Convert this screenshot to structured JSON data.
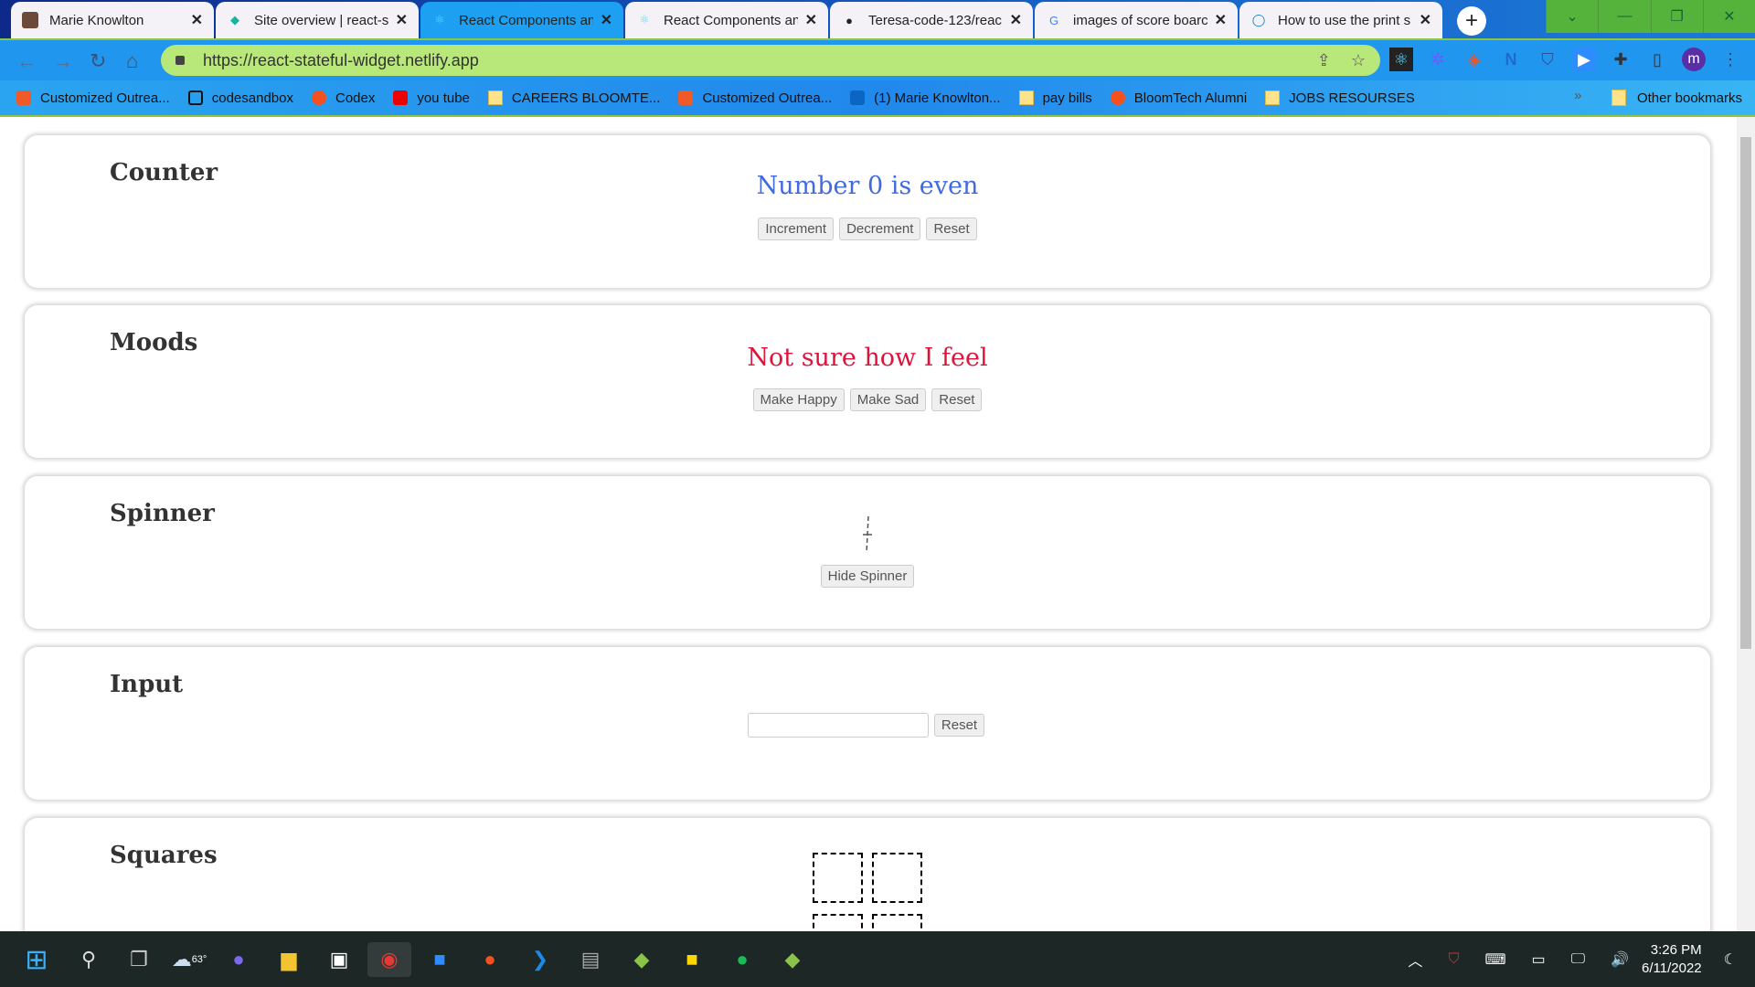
{
  "browser": {
    "tabs": [
      {
        "title": "Marie Knowlton",
        "icon": "profile-photo-icon"
      },
      {
        "title": "Site overview | react-s",
        "icon": "netlify-icon"
      },
      {
        "title": "React Components an",
        "icon": "react-icon",
        "active": true
      },
      {
        "title": "React Components an",
        "icon": "react-icon"
      },
      {
        "title": "Teresa-code-123/reac",
        "icon": "github-icon"
      },
      {
        "title": "images of score boarc",
        "icon": "google-icon"
      },
      {
        "title": "How to use the print s",
        "icon": "dell-icon"
      }
    ],
    "url": "https://react-stateful-widget.netlify.app",
    "profile_initial": "m",
    "bookmarks": [
      {
        "label": "Customized Outrea...",
        "icon": "outreach-icon"
      },
      {
        "label": "codesandbox",
        "icon": "codesandbox-icon"
      },
      {
        "label": "Codex",
        "icon": "codex-icon"
      },
      {
        "label": "you tube",
        "icon": "youtube-icon"
      },
      {
        "label": "CAREERS BLOOMTE...",
        "icon": "folder-icon"
      },
      {
        "label": "Customized Outrea...",
        "icon": "outreach-icon"
      },
      {
        "label": "(1) Marie Knowlton...",
        "icon": "linkedin-icon"
      },
      {
        "label": "pay bills",
        "icon": "folder-icon"
      },
      {
        "label": "BloomTech Alumni",
        "icon": "codex-icon"
      },
      {
        "label": "JOBS RESOURSES",
        "icon": "folder-icon"
      }
    ],
    "more_bookmarks": "»",
    "other_bookmarks": "Other bookmarks"
  },
  "widgets": {
    "counter": {
      "title": "Counter",
      "message": "Number 0 is even",
      "color": "#4169e1",
      "buttons": [
        "Increment",
        "Decrement",
        "Reset"
      ]
    },
    "moods": {
      "title": "Moods",
      "message": "Not sure how I feel",
      "color": "#dc143c",
      "buttons": [
        "Make Happy",
        "Make Sad",
        "Reset"
      ]
    },
    "spinner": {
      "title": "Spinner",
      "button": "Hide Spinner"
    },
    "input": {
      "title": "Input",
      "value": "",
      "button": "Reset"
    },
    "squares": {
      "title": "Squares"
    }
  },
  "taskbar": {
    "weather": "63°",
    "time": "3:26 PM",
    "date": "6/11/2022"
  }
}
